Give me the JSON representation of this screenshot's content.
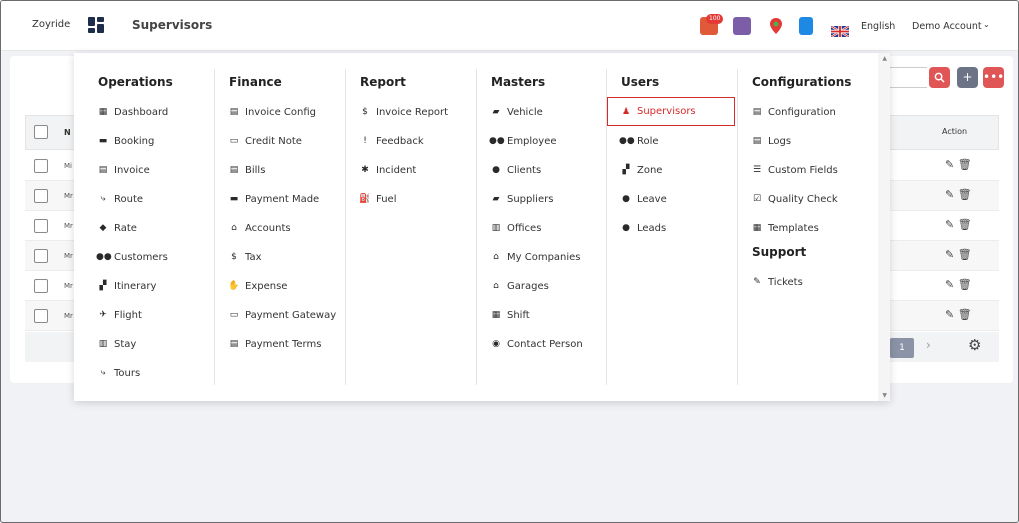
{
  "header": {
    "brand": "Zoyride",
    "title": "Supervisors",
    "notification_count": "100",
    "language": "English",
    "account": "Demo Account"
  },
  "table": {
    "action_header": "Action",
    "col_header_stub": "N",
    "row_prefixes": [
      "Mi",
      "Mr",
      "Mr",
      "Mr",
      "Mr",
      "Mr"
    ],
    "current_page": "1"
  },
  "menu": {
    "operations": {
      "title": "Operations",
      "items": [
        "Dashboard",
        "Booking",
        "Invoice",
        "Route",
        "Rate",
        "Customers",
        "Itinerary",
        "Flight",
        "Stay",
        "Tours"
      ]
    },
    "finance": {
      "title": "Finance",
      "items": [
        "Invoice Config",
        "Credit Note",
        "Bills",
        "Payment Made",
        "Accounts",
        "Tax",
        "Expense",
        "Payment Gateway",
        "Payment Terms"
      ]
    },
    "report": {
      "title": "Report",
      "items": [
        "Invoice Report",
        "Feedback",
        "Incident",
        "Fuel"
      ]
    },
    "masters": {
      "title": "Masters",
      "items": [
        "Vehicle",
        "Employee",
        "Clients",
        "Suppliers",
        "Offices",
        "My Companies",
        "Garages",
        "Shift",
        "Contact Person"
      ]
    },
    "users": {
      "title": "Users",
      "items": [
        "Supervisors",
        "Role",
        "Zone",
        "Leave",
        "Leads"
      ],
      "active": "Supervisors"
    },
    "configurations": {
      "title": "Configurations",
      "items": [
        "Configuration",
        "Logs",
        "Custom Fields",
        "Quality Check",
        "Templates"
      ]
    },
    "support": {
      "title": "Support",
      "items": [
        "Tickets"
      ]
    }
  },
  "colors": {
    "accent_red": "#d62b2b",
    "search_button": "#e05555",
    "add_button": "#6c7387",
    "more_button": "#e05555",
    "nav_dark": "#1f2d4d"
  }
}
